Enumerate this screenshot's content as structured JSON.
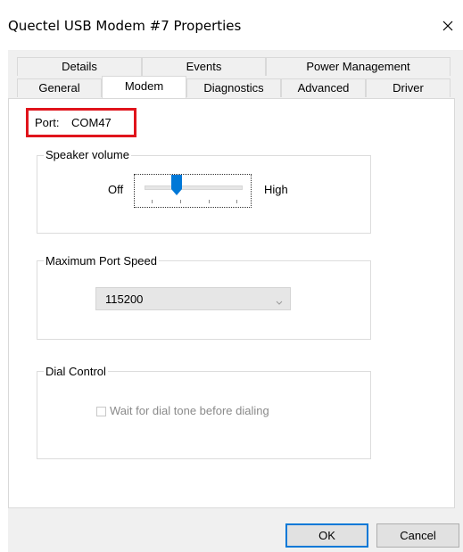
{
  "window": {
    "title": "Quectel USB Modem #7 Properties"
  },
  "tabs": {
    "row_back": [
      "Details",
      "Events",
      "Power Management"
    ],
    "row_front": [
      "General",
      "Modem",
      "Diagnostics",
      "Advanced",
      "Driver"
    ],
    "selected": "Modem"
  },
  "port": {
    "label": "Port:",
    "value": "COM47"
  },
  "speaker": {
    "group_title": "Speaker volume",
    "low_label": "Off",
    "high_label": "High",
    "level_fraction": 0.33
  },
  "max_port_speed": {
    "group_title": "Maximum Port Speed",
    "selected_value": "115200"
  },
  "dial_control": {
    "group_title": "Dial Control",
    "checkbox_label": "Wait for dial tone before dialing",
    "checked": false,
    "enabled": false
  },
  "buttons": {
    "ok": "OK",
    "cancel": "Cancel"
  },
  "colors": {
    "highlight_box": "#e0141c",
    "accent": "#0078d7"
  }
}
